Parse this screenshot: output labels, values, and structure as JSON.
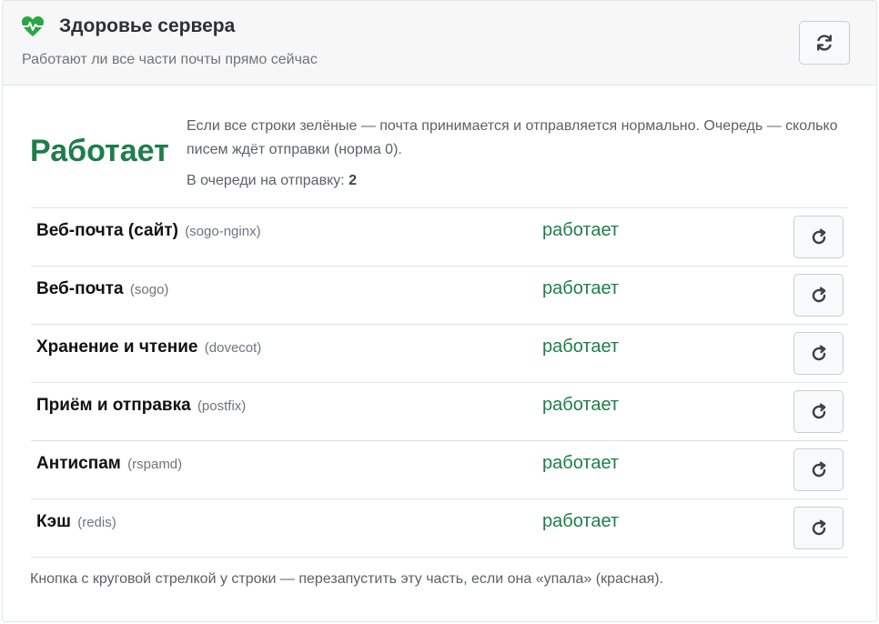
{
  "header": {
    "title": "Здоровье сервера",
    "subtitle": "Работают ли все части почты прямо сейчас",
    "icon": "heart-pulse-icon",
    "refresh_icon": "refresh-icon"
  },
  "summary": {
    "status": "Работает",
    "description": "Если все строки зелёные — почта принимается и отправляется нормально. Очередь — сколько писем ждёт отправки (норма 0).",
    "queue_label": "В очереди на отправку:",
    "queue_value": "2"
  },
  "services": [
    {
      "name": "Веб-почта (сайт)",
      "id": "(sogo-nginx)",
      "status": "работает"
    },
    {
      "name": "Веб-почта",
      "id": "(sogo)",
      "status": "работает"
    },
    {
      "name": "Хранение и чтение",
      "id": "(dovecot)",
      "status": "работает"
    },
    {
      "name": "Приём и отправка",
      "id": "(postfix)",
      "status": "работает"
    },
    {
      "name": "Антиспам",
      "id": "(rspamd)",
      "status": "работает"
    },
    {
      "name": "Кэш",
      "id": "(redis)",
      "status": "работает"
    }
  ],
  "footer": {
    "note": "Кнопка с круговой стрелкой у строки — перезапустить эту часть, если она «упала» (красная)."
  },
  "colors": {
    "ok": "#1e7e4a",
    "accent": "#28a745"
  }
}
